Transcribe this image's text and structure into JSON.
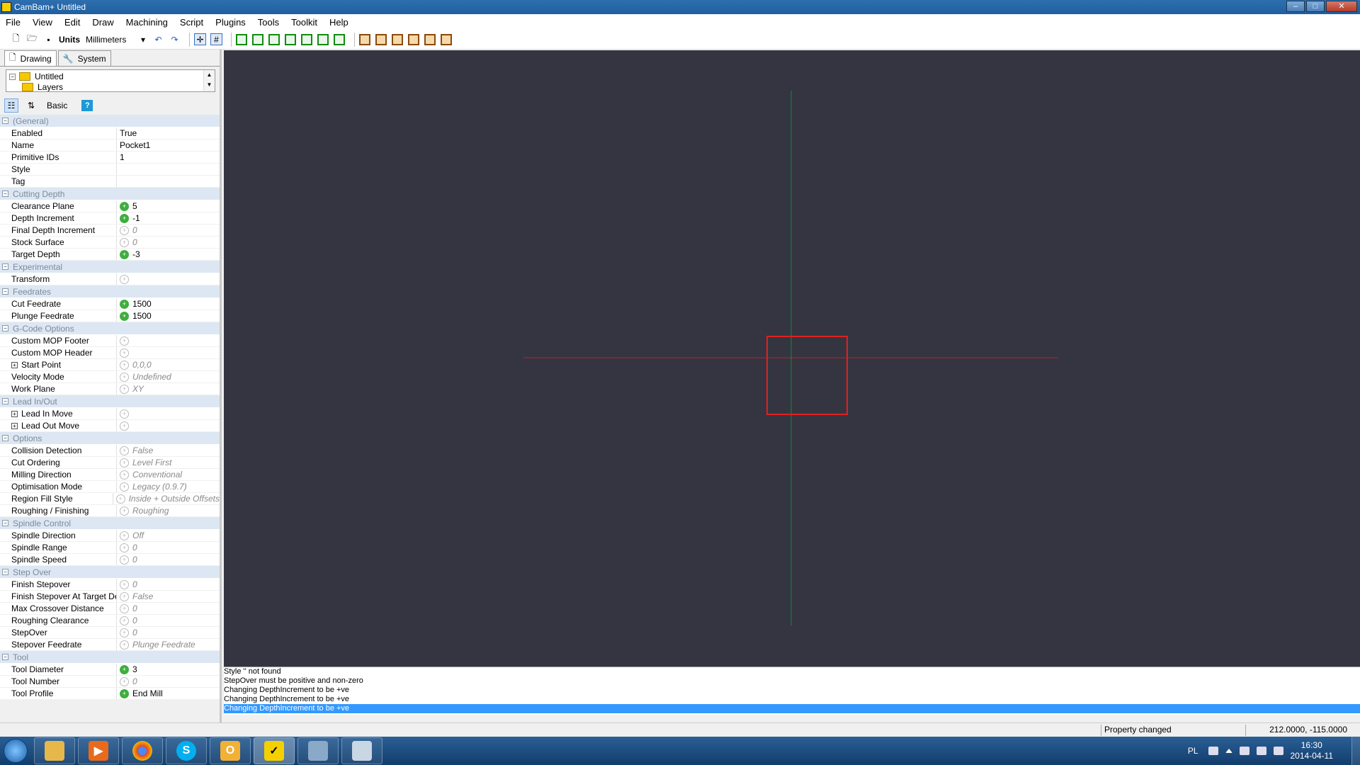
{
  "window": {
    "title": "CamBam+  Untitled"
  },
  "menu": [
    "File",
    "View",
    "Edit",
    "Draw",
    "Machining",
    "Script",
    "Plugins",
    "Tools",
    "Toolkit",
    "Help"
  ],
  "toolbar": {
    "units_label": "Units",
    "units_value": "Millimeters"
  },
  "tabs": [
    {
      "label": "Drawing"
    },
    {
      "label": "System"
    }
  ],
  "tree": {
    "root": "Untitled",
    "child": "Layers"
  },
  "propbar": {
    "basic_label": "Basic",
    "help_label": "?"
  },
  "properties": [
    {
      "category": "(General)",
      "rows": [
        {
          "name": "Enabled",
          "value": "True",
          "indicator": "none",
          "default": false
        },
        {
          "name": "Name",
          "value": "Pocket1",
          "indicator": "none",
          "default": false
        },
        {
          "name": "Primitive IDs",
          "value": "1",
          "indicator": "none",
          "default": false
        },
        {
          "name": "Style",
          "value": "",
          "indicator": "none",
          "default": false
        },
        {
          "name": "Tag",
          "value": "",
          "indicator": "none",
          "default": false
        }
      ]
    },
    {
      "category": "Cutting Depth",
      "rows": [
        {
          "name": "Clearance Plane",
          "value": "5",
          "indicator": "on",
          "default": false
        },
        {
          "name": "Depth Increment",
          "value": "-1",
          "indicator": "on",
          "default": false
        },
        {
          "name": "Final Depth Increment",
          "value": "0",
          "indicator": "off",
          "default": true
        },
        {
          "name": "Stock Surface",
          "value": "0",
          "indicator": "off",
          "default": true
        },
        {
          "name": "Target Depth",
          "value": "-3",
          "indicator": "on",
          "default": false
        }
      ]
    },
    {
      "category": "Experimental",
      "rows": [
        {
          "name": "Transform",
          "value": "",
          "indicator": "off",
          "default": true
        }
      ]
    },
    {
      "category": "Feedrates",
      "rows": [
        {
          "name": "Cut Feedrate",
          "value": "1500",
          "indicator": "on",
          "default": false
        },
        {
          "name": "Plunge Feedrate",
          "value": "1500",
          "indicator": "on",
          "default": false
        }
      ]
    },
    {
      "category": "G-Code Options",
      "rows": [
        {
          "name": "Custom MOP Footer",
          "value": "",
          "indicator": "off",
          "default": true
        },
        {
          "name": "Custom MOP Header",
          "value": "",
          "indicator": "off",
          "default": true
        },
        {
          "name": "Start Point",
          "value": "0,0,0",
          "indicator": "off",
          "default": true,
          "expandable": true
        },
        {
          "name": "Velocity Mode",
          "value": "Undefined",
          "indicator": "off",
          "default": true
        },
        {
          "name": "Work Plane",
          "value": "XY",
          "indicator": "off",
          "default": true
        }
      ]
    },
    {
      "category": "Lead In/Out",
      "rows": [
        {
          "name": "Lead In Move",
          "value": "",
          "indicator": "off",
          "default": true,
          "expandable": true
        },
        {
          "name": "Lead Out Move",
          "value": "",
          "indicator": "off",
          "default": true,
          "expandable": true
        }
      ]
    },
    {
      "category": "Options",
      "rows": [
        {
          "name": "Collision Detection",
          "value": "False",
          "indicator": "off",
          "default": true
        },
        {
          "name": "Cut Ordering",
          "value": "Level First",
          "indicator": "off",
          "default": true
        },
        {
          "name": "Milling Direction",
          "value": "Conventional",
          "indicator": "off",
          "default": true
        },
        {
          "name": "Optimisation Mode",
          "value": "Legacy (0.9.7)",
          "indicator": "off",
          "default": true
        },
        {
          "name": "Region Fill Style",
          "value": "Inside + Outside Offsets",
          "indicator": "off",
          "default": true
        },
        {
          "name": "Roughing / Finishing",
          "value": "Roughing",
          "indicator": "off",
          "default": true
        }
      ]
    },
    {
      "category": "Spindle Control",
      "rows": [
        {
          "name": "Spindle Direction",
          "value": "Off",
          "indicator": "off",
          "default": true
        },
        {
          "name": "Spindle Range",
          "value": "0",
          "indicator": "off",
          "default": true
        },
        {
          "name": "Spindle Speed",
          "value": "0",
          "indicator": "off",
          "default": true
        }
      ]
    },
    {
      "category": "Step Over",
      "rows": [
        {
          "name": "Finish Stepover",
          "value": "0",
          "indicator": "off",
          "default": true
        },
        {
          "name": "Finish Stepover At Target De",
          "value": "False",
          "indicator": "off",
          "default": true
        },
        {
          "name": "Max Crossover Distance",
          "value": "0",
          "indicator": "off",
          "default": true
        },
        {
          "name": "Roughing Clearance",
          "value": "0",
          "indicator": "off",
          "default": true
        },
        {
          "name": "StepOver",
          "value": "0",
          "indicator": "off",
          "default": true
        },
        {
          "name": "Stepover Feedrate",
          "value": "Plunge Feedrate",
          "indicator": "off",
          "default": true
        }
      ]
    },
    {
      "category": "Tool",
      "rows": [
        {
          "name": "Tool Diameter",
          "value": "3",
          "indicator": "on",
          "default": false
        },
        {
          "name": "Tool Number",
          "value": "0",
          "indicator": "off",
          "default": true
        },
        {
          "name": "Tool Profile",
          "value": "End Mill",
          "indicator": "on",
          "default": false
        }
      ]
    }
  ],
  "console": [
    {
      "text": "Style '' not found",
      "selected": false
    },
    {
      "text": "StepOver must be positive and non-zero",
      "selected": false
    },
    {
      "text": "Changing DepthIncrement to be +ve",
      "selected": false
    },
    {
      "text": "Changing DepthIncrement to be +ve",
      "selected": false
    },
    {
      "text": "Changing DepthIncrement to be +ve",
      "selected": true
    }
  ],
  "status": {
    "message": "Property changed",
    "coords": "212.0000, -115.0000"
  },
  "tray": {
    "lang": "PL",
    "time": "16:30",
    "date": "2014-04-11"
  },
  "colors": {
    "canvas_bg": "#343540",
    "x_axis": "#cc1a1a",
    "y_axis": "#1a8a2a",
    "shape": "#e02020"
  }
}
